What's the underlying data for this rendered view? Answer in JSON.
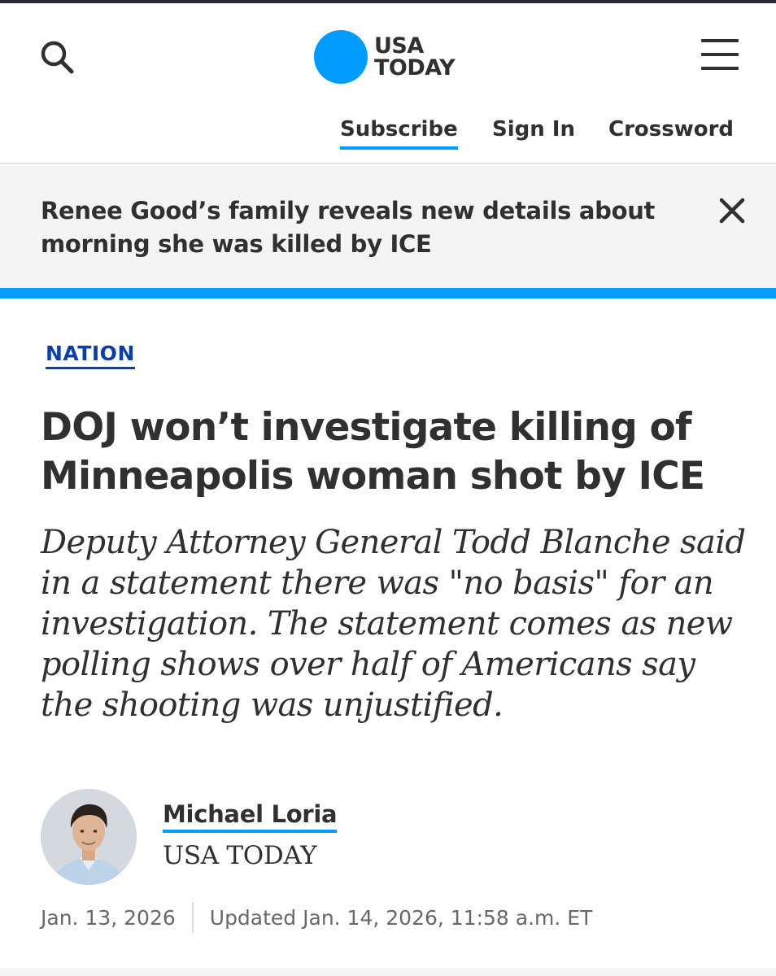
{
  "header": {
    "logo_line1": "USA",
    "logo_line2": "TODAY",
    "brand_color": "#009bff",
    "search_icon": "search-icon",
    "menu_icon": "hamburger-menu-icon"
  },
  "top_links": {
    "subscribe": "Subscribe",
    "sign_in": "Sign In",
    "crossword": "Crossword"
  },
  "alert": {
    "text": "Renee Good’s family reveals new details about morning she was killed by ICE",
    "close_icon": "close-icon"
  },
  "article": {
    "section": "NATION",
    "headline": "DOJ won’t investigate killing of Minneapolis woman shot by ICE",
    "dek": "Deputy Attorney General Todd Blanche said in a statement there was \"no basis\" for an investigation. The statement comes as new polling shows over half of Americans say the shooting was unjustified.",
    "author": {
      "name": "Michael Loria",
      "organization": "USA TODAY"
    },
    "published": "Jan. 13, 2026",
    "updated": "Updated Jan. 14, 2026, 11:58 a.m. ET"
  }
}
